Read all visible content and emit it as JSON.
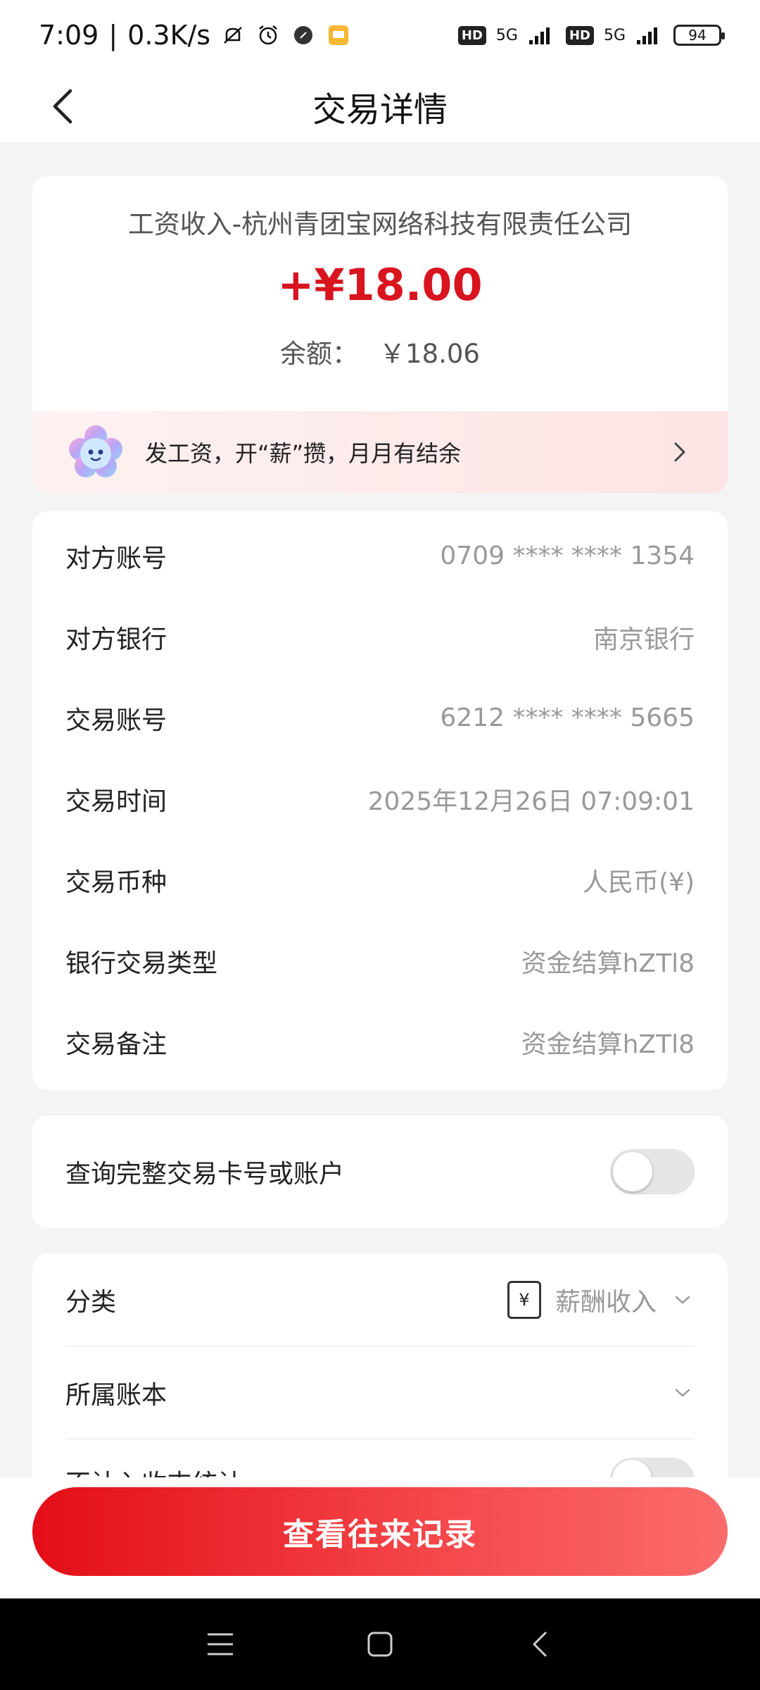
{
  "status_bar": {
    "time": "7:09",
    "speed": "0.3K/s",
    "network1": "5G",
    "network2": "5G",
    "hd1": "HD",
    "hd2": "HD",
    "battery": "94"
  },
  "header": {
    "title": "交易详情"
  },
  "summary": {
    "source": "工资收入-杭州青团宝网络科技有限责任公司",
    "amount": "+¥18.00",
    "balance_label": "余额：",
    "balance_value": "￥18.06",
    "promo_text": "发工资，开“薪”攒，月月有结余"
  },
  "details": [
    {
      "label": "对方账号",
      "value": "0709 **** **** 1354"
    },
    {
      "label": "对方银行",
      "value": "南京银行"
    },
    {
      "label": "交易账号",
      "value": "6212 **** **** 5665"
    },
    {
      "label": "交易时间",
      "value": "2025年12月26日 07:09:01"
    },
    {
      "label": "交易币种",
      "value": "人民币(¥)"
    },
    {
      "label": "银行交易类型",
      "value": "资金结算hZTl8"
    },
    {
      "label": "交易备注",
      "value": "资金结算hZTl8"
    }
  ],
  "query_toggle": {
    "label": "查询完整交易卡号或账户",
    "on": false
  },
  "category": {
    "category_label": "分类",
    "category_icon": "yen-icon",
    "category_icon_glyph": "¥",
    "category_value": "薪酬收入",
    "ledger_label": "所属账本",
    "partial_label": "不计入收支统计"
  },
  "actions": {
    "primary_label": "查看往来记录"
  },
  "colors": {
    "accent": "#d8141f",
    "button_start": "#e30d17",
    "button_end": "#fb6b6b"
  }
}
